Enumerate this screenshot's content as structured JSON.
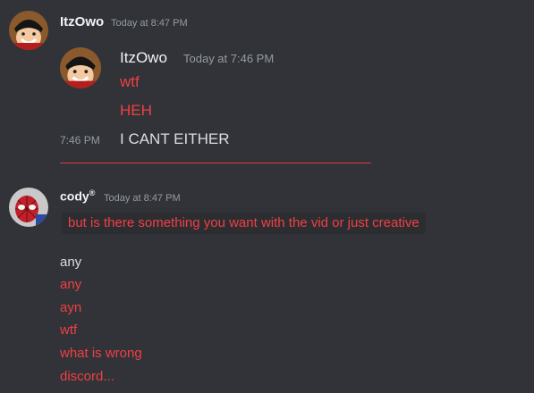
{
  "messages": {
    "first": {
      "author": "ItzOwo",
      "timestamp": "Today at 8:47 PM",
      "avatar_icon": "luffy-avatar-icon"
    },
    "quoted": {
      "author": "ItzOwo",
      "timestamp": "Today at 7:46 PM",
      "lines": [
        "wtf",
        "HEH"
      ],
      "inline_time": "7:46 PM",
      "inline_text": "I CANT EITHER"
    },
    "second": {
      "author": "cody",
      "author_badge": "®",
      "timestamp": "Today at 8:47 PM",
      "code_text": "but is there something you want with the vid or just creative",
      "avatar_icon": "spiderman-avatar-icon"
    },
    "list": [
      "any",
      "any",
      "ayn",
      "wtf",
      "what is wrong",
      "discord..."
    ]
  },
  "colors": {
    "background": "#313338",
    "red_text": "#f23f43",
    "muted": "#949ba4"
  }
}
